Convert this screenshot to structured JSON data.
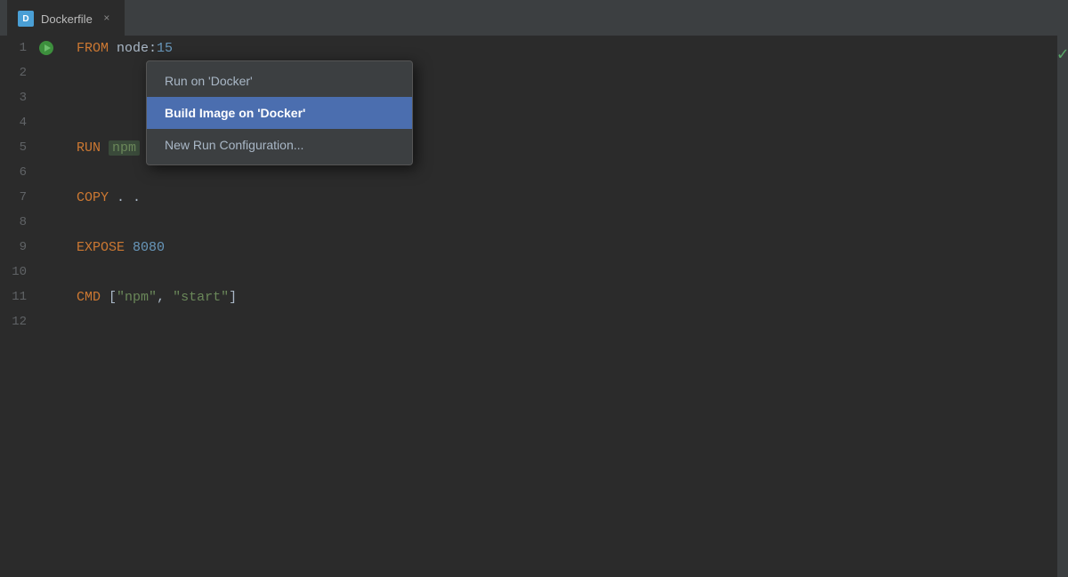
{
  "tab": {
    "label": "Dockerfile",
    "close": "×",
    "icon_letter": "D"
  },
  "check_mark": "✓",
  "dropdown": {
    "items": [
      {
        "id": "run-docker",
        "label": "Run on 'Docker'",
        "selected": false
      },
      {
        "id": "build-image-docker",
        "label": "Build Image on 'Docker'",
        "selected": true
      },
      {
        "id": "new-run-config",
        "label": "New Run Configuration...",
        "selected": false
      }
    ]
  },
  "lines": [
    {
      "num": "1",
      "has_run_icon": true,
      "content": "FROM node:15"
    },
    {
      "num": "2",
      "has_run_icon": false,
      "content": ""
    },
    {
      "num": "3",
      "has_run_icon": false,
      "content": ""
    },
    {
      "num": "4",
      "has_run_icon": false,
      "content": ""
    },
    {
      "num": "5",
      "has_run_icon": false,
      "content": "RUN npm install"
    },
    {
      "num": "6",
      "has_run_icon": false,
      "content": ""
    },
    {
      "num": "7",
      "has_run_icon": false,
      "content": "COPY . ."
    },
    {
      "num": "8",
      "has_run_icon": false,
      "content": ""
    },
    {
      "num": "9",
      "has_run_icon": false,
      "content": "EXPOSE 8080"
    },
    {
      "num": "10",
      "has_run_icon": false,
      "content": ""
    },
    {
      "num": "11",
      "has_run_icon": false,
      "content": "CMD [\"npm\", \"start\"]"
    },
    {
      "num": "12",
      "has_run_icon": false,
      "content": ""
    }
  ]
}
